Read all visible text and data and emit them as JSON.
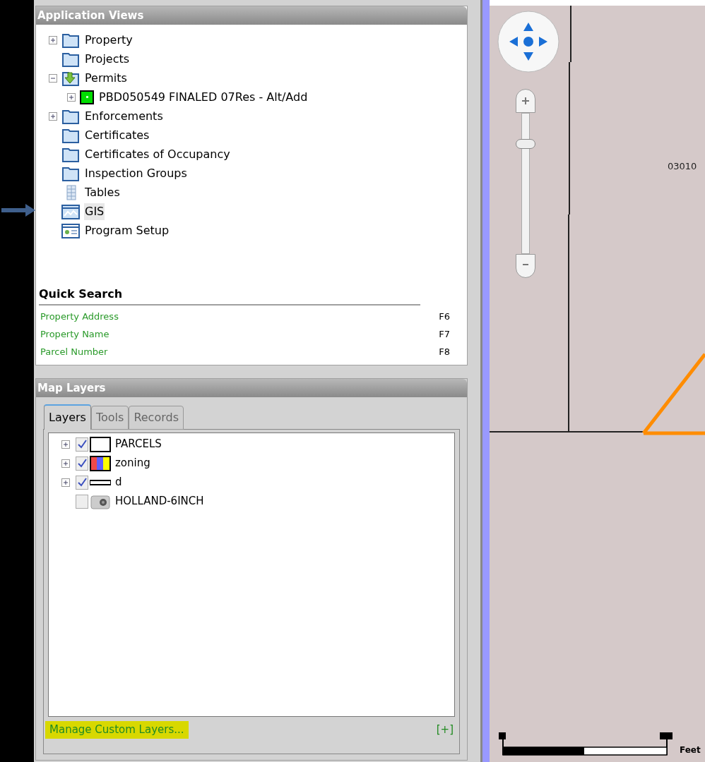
{
  "app_views": {
    "title": "Application Views",
    "tree": [
      {
        "label": "Property",
        "kind": "folder",
        "expanded": false,
        "selected": false
      },
      {
        "label": "Projects",
        "kind": "folder",
        "selected": false
      },
      {
        "label": "Permits",
        "kind": "permit",
        "expanded": true,
        "selected": false,
        "children": [
          {
            "label": "PBD050549 FINALED 07Res - Alt/Add",
            "kind": "record",
            "expanded": false,
            "selected": false
          }
        ]
      },
      {
        "label": "Enforcements",
        "kind": "folder",
        "expanded": false,
        "selected": false
      },
      {
        "label": "Certificates",
        "kind": "folder",
        "selected": false
      },
      {
        "label": "Certificates of Occupancy",
        "kind": "folder",
        "selected": false
      },
      {
        "label": "Inspection Groups",
        "kind": "folder",
        "selected": false
      },
      {
        "label": "Tables",
        "kind": "tables",
        "selected": false
      },
      {
        "label": "GIS",
        "kind": "gis",
        "selected": true
      },
      {
        "label": "Program Setup",
        "kind": "setup",
        "selected": false
      }
    ]
  },
  "quick_search": {
    "title": "Quick Search",
    "items": [
      {
        "label": "Property Address",
        "key": "F6"
      },
      {
        "label": "Property Name",
        "key": "F7"
      },
      {
        "label": "Parcel Number",
        "key": "F8"
      }
    ]
  },
  "map_layers": {
    "title": "Map Layers",
    "tabs": [
      {
        "label": "Layers",
        "selected": true
      },
      {
        "label": "Tools",
        "selected": false
      },
      {
        "label": "Records",
        "selected": false
      }
    ],
    "layers": [
      {
        "label": "PARCELS",
        "checked": true,
        "kind": "outline"
      },
      {
        "label": "zoning",
        "checked": true,
        "kind": "zones"
      },
      {
        "label": "d",
        "checked": true,
        "kind": "line"
      },
      {
        "label": "HOLLAND-6INCH",
        "checked": false,
        "kind": "camera"
      }
    ],
    "manage_link": "Manage Custom Layers...",
    "add_button": "[+]"
  },
  "map": {
    "parcel_label": "03010",
    "zoom": {
      "level": 0.8
    },
    "scale_unit": "Feet"
  }
}
